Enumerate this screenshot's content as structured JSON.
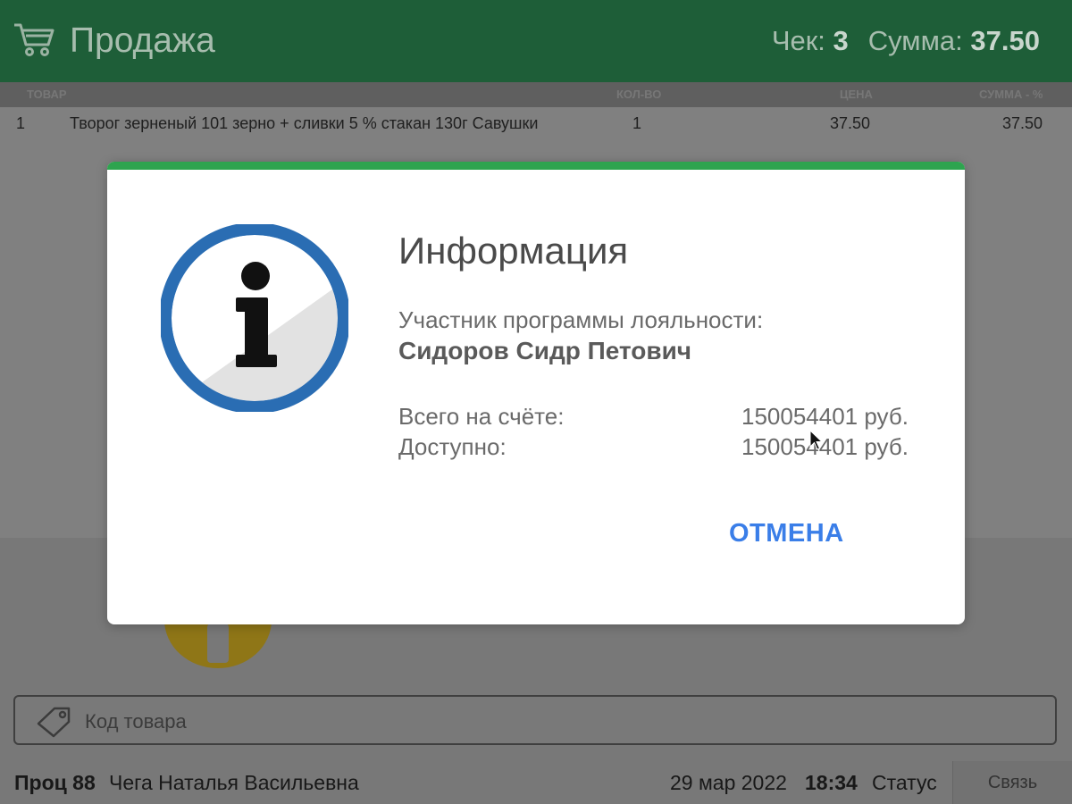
{
  "header": {
    "title": "Продажа",
    "receipt_label": "Чек:",
    "receipt_number": "3",
    "sum_label": "Сумма:",
    "sum_value": "37.50"
  },
  "table": {
    "columns": [
      "ТОВАР",
      "КОЛ-ВО",
      "ЦЕНА",
      "СУММА - %"
    ],
    "rows": [
      {
        "num": "1",
        "name": "Творог зерненый 101 зерно + сливки 5 % стакан 130г Савушки",
        "qty": "1",
        "price": "37.50",
        "sum": "37.50"
      }
    ]
  },
  "modal": {
    "title": "Информация",
    "loyalty_label": "Участник программы лояльности:",
    "customer_name": "Сидоров Сидр Петович",
    "total_label": "Всего на счёте:",
    "total_value": "150054401 руб.",
    "available_label": "Доступно:",
    "available_value": "150054401 руб.",
    "cancel_label": "ОТМЕНА",
    "accent_color": "#2ea44f",
    "button_color": "#3a7ee8"
  },
  "product_code": {
    "placeholder": "Код товара",
    "icon": "tag-icon"
  },
  "status_bar": {
    "proc_label": "Проц 88",
    "cashier": "Чега Наталья Васильевна",
    "date": "29 мар 2022",
    "time": "18:34",
    "status_label": "Статус",
    "link_label": "Связь"
  },
  "colors": {
    "header_bg": "#1e5e38",
    "overlay": "#808080"
  }
}
